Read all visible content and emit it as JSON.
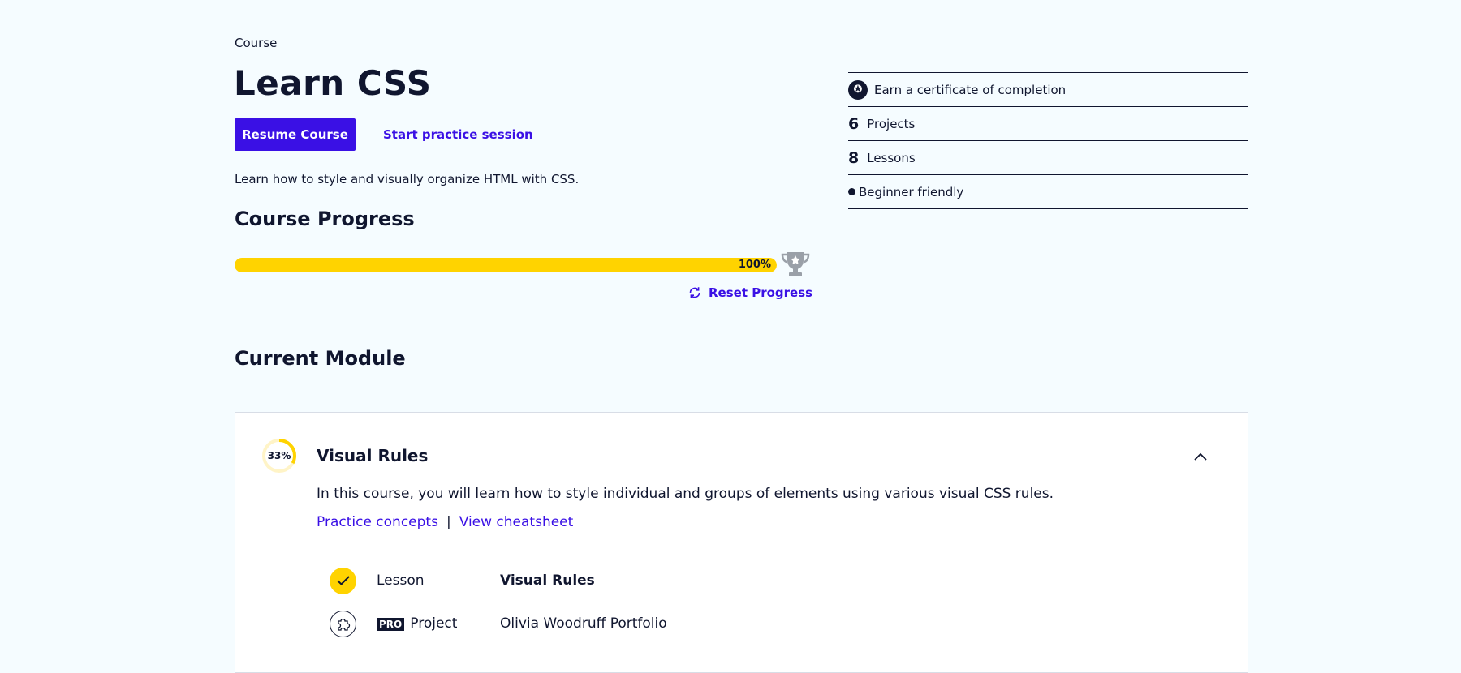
{
  "header": {
    "eyebrow": "Course",
    "title": "Learn CSS",
    "primary_button": "Resume Course",
    "secondary_link": "Start practice session",
    "description": "Learn how to style and visually organize HTML with CSS."
  },
  "progress": {
    "heading": "Course Progress",
    "percent": 100,
    "percent_label": "100%",
    "reset_label": "Reset Progress",
    "trophy_icon": "trophy-icon"
  },
  "stats": {
    "certificate": "Earn a certificate of completion",
    "projects_count": "6",
    "projects_label": "Projects",
    "lessons_count": "8",
    "lessons_label": "Lessons",
    "level": "Beginner friendly"
  },
  "current_module": {
    "heading": "Current Module",
    "progress_percent": 33,
    "progress_label": "33%",
    "name": "Visual Rules",
    "description": "In this course, you will learn how to style individual and groups of elements using various visual CSS rules.",
    "link_practice": "Practice concepts",
    "separator": "|",
    "link_cheatsheet": "View cheatsheet",
    "items": [
      {
        "type": "Lesson",
        "name": "Visual Rules",
        "status": "complete",
        "icon": "check-icon"
      },
      {
        "type": "Project",
        "badge": "PRO",
        "name": "Olivia Woodruff Portfolio",
        "status": "incomplete",
        "icon": "puzzle-icon"
      }
    ]
  },
  "colors": {
    "accent": "#3a10e5",
    "progress_fill": "#ffd300",
    "background": "#f5fcff",
    "text": "#10162f"
  }
}
